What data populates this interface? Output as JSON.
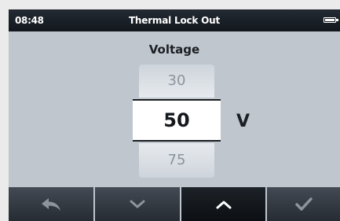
{
  "statusbar": {
    "time": "08:48",
    "title": "Thermal Lock Out",
    "battery_icon": "battery-full-icon"
  },
  "setting": {
    "label": "Voltage",
    "previous_value": "30",
    "current_value": "50",
    "next_value": "75",
    "unit": "V"
  },
  "softkeys": [
    {
      "icon": "back-arrow-icon"
    },
    {
      "icon": "chevron-down-icon"
    },
    {
      "icon": "chevron-up-icon",
      "active": true
    },
    {
      "icon": "checkmark-icon"
    }
  ]
}
